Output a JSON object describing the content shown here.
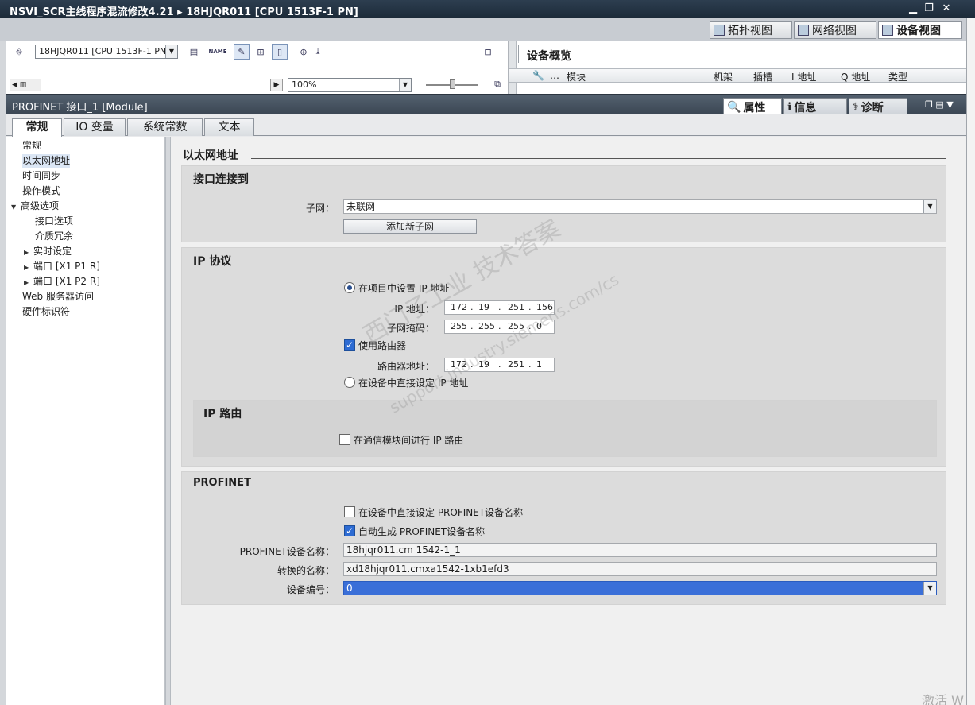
{
  "window": {
    "title": "NSVI_SCR主线程序混流修改4.21 ▸ 18HJQR011 [CPU 1513F-1 PN]"
  },
  "view_tabs": [
    "拓扑视图",
    "网络视图",
    "设备视图"
  ],
  "device_toolbar": {
    "device_select": "18HJQR011 [CPU 1513F-1 PN]",
    "zoom": "100%",
    "name_icon": "NAME"
  },
  "overview": {
    "tab": "设备概览",
    "columns": [
      "模块",
      "机架",
      "插槽",
      "I 地址",
      "Q 地址",
      "类型"
    ]
  },
  "inspector": {
    "title": "PROFINET 接口_1 [Module]",
    "tabs": [
      "属性",
      "信息",
      "诊断"
    ]
  },
  "subtabs": [
    "常规",
    "IO 变量",
    "系统常数",
    "文本"
  ],
  "nav": {
    "items": [
      "常规",
      "以太网地址",
      "时间同步",
      "操作模式",
      "高级选项",
      "接口选项",
      "介质冗余",
      "实时设定",
      "端口 [X1 P1 R]",
      "端口 [X1 P2 R]",
      "Web 服务器访问",
      "硬件标识符"
    ]
  },
  "content": {
    "section_title": "以太网地址",
    "interface": {
      "title": "接口连接到",
      "subnet_label": "子网：",
      "subnet_value": "未联网",
      "add_subnet": "添加新子网"
    },
    "ip": {
      "title": "IP 协议",
      "set_in_project": "在项目中设置 IP 地址",
      "ip_label": "IP 地址：",
      "ip": [
        "172",
        "19",
        "251",
        "156"
      ],
      "mask_label": "子网掩码：",
      "mask": [
        "255",
        "255",
        "255",
        "0"
      ],
      "use_router": "使用路由器",
      "router_label": "路由器地址：",
      "router": [
        "172",
        "19",
        "251",
        "1"
      ],
      "set_on_device": "在设备中直接设定 IP 地址"
    },
    "ip_routing": {
      "title": "IP 路由",
      "option": "在通信模块间进行 IP 路由"
    },
    "profinet": {
      "title": "PROFINET",
      "set_name_on_device": "在设备中直接设定 PROFINET设备名称",
      "auto_name": "自动生成 PROFINET设备名称",
      "name_label": "PROFINET设备名称：",
      "name_value": "18hjqr011.cm 1542-1_1",
      "converted_label": "转换的名称：",
      "converted_value": "xd18hjqr011.cmxa1542-1xb1efd3",
      "device_no_label": "设备编号：",
      "device_no_value": "0"
    }
  },
  "watermark": {
    "line1": "西门子工业 技术答案",
    "line2": "support.industry.siemens.com/cs"
  },
  "os_text": "激活 W"
}
